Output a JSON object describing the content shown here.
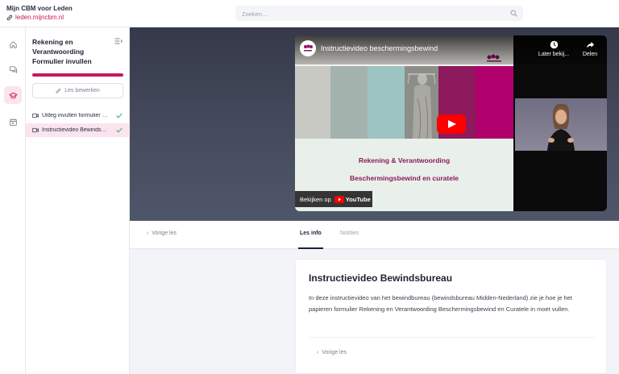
{
  "brand": {
    "title": "Mijn CBM voor Leden",
    "link": "leden.mijncbm.nl",
    "accent_color": "#c7175f"
  },
  "search": {
    "placeholder": "Zoeken...",
    "icon": "search-icon"
  },
  "rail": {
    "items": [
      {
        "icon": "home-icon",
        "active": false
      },
      {
        "icon": "chat-icon",
        "active": false
      },
      {
        "icon": "graduation-cap-icon",
        "active": true
      },
      {
        "icon": "calendar-icon",
        "active": false
      }
    ]
  },
  "course": {
    "title": "Rekening en Verantwoording Formulier invullen",
    "progress": 1.0,
    "edit_label": "Les bewerken",
    "lessons": [
      {
        "label": "Uitleg invullen formulier Rekening en Verantwoording",
        "completed": true,
        "active": false
      },
      {
        "label": "Instructievideo Bewindsbureau",
        "completed": true,
        "active": true
      }
    ]
  },
  "video": {
    "title": "Instructievideo beschermingsbewind",
    "watch_later": "Later bekij...",
    "share": "Delen",
    "watch_on": "Bekijken op",
    "youtube": "YouTube",
    "slide_line1": "Rekening & Verantwoording",
    "slide_line2": "Beschermingsbewind en curatele"
  },
  "tabs": {
    "prev": "Vorige les",
    "items": [
      {
        "label": "Les info",
        "active": true
      },
      {
        "label": "Notities",
        "active": false
      }
    ]
  },
  "lesson": {
    "title": "Instructievideo Bewindsbureau",
    "description": "In deze instructievideo van het bewindbureau (bewindsbureau Midden-Nederland) zie je hoe je het papieren formulier Rekening en Verantwoording Beschermingsbewind en Curatele in moet vullen.",
    "prev": "Vorige les"
  }
}
